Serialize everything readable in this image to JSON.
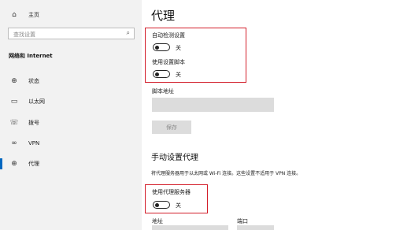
{
  "sidebar": {
    "home_label": "主页",
    "home_icon": "home-icon",
    "search_placeholder": "查找设置",
    "search_icon": "search-icon",
    "section_title": "网络和 Internet",
    "items": [
      {
        "label": "状态",
        "icon": "globe-status-icon"
      },
      {
        "label": "以太网",
        "icon": "monitor-ethernet-icon"
      },
      {
        "label": "拨号",
        "icon": "phone-dialup-icon"
      },
      {
        "label": "VPN",
        "icon": "vpn-icon"
      },
      {
        "label": "代理",
        "icon": "globe-proxy-icon",
        "active": true
      }
    ]
  },
  "main": {
    "title": "代理",
    "auto": {
      "detect_label": "自动检测设置",
      "detect_state": "关",
      "script_label": "使用设置脚本",
      "script_state": "关",
      "script_address_label": "脚本地址",
      "save_button": "保存"
    },
    "manual": {
      "heading": "手动设置代理",
      "description": "将代理服务器用于以太网或 Wi-Fi 连接。这些设置不适用于 VPN 连接。",
      "use_proxy_label": "使用代理服务器",
      "use_proxy_state": "关",
      "address_label": "地址",
      "port_label": "端口"
    }
  },
  "colors": {
    "highlight_border": "#d31f2b",
    "accent": "#0067c0"
  }
}
